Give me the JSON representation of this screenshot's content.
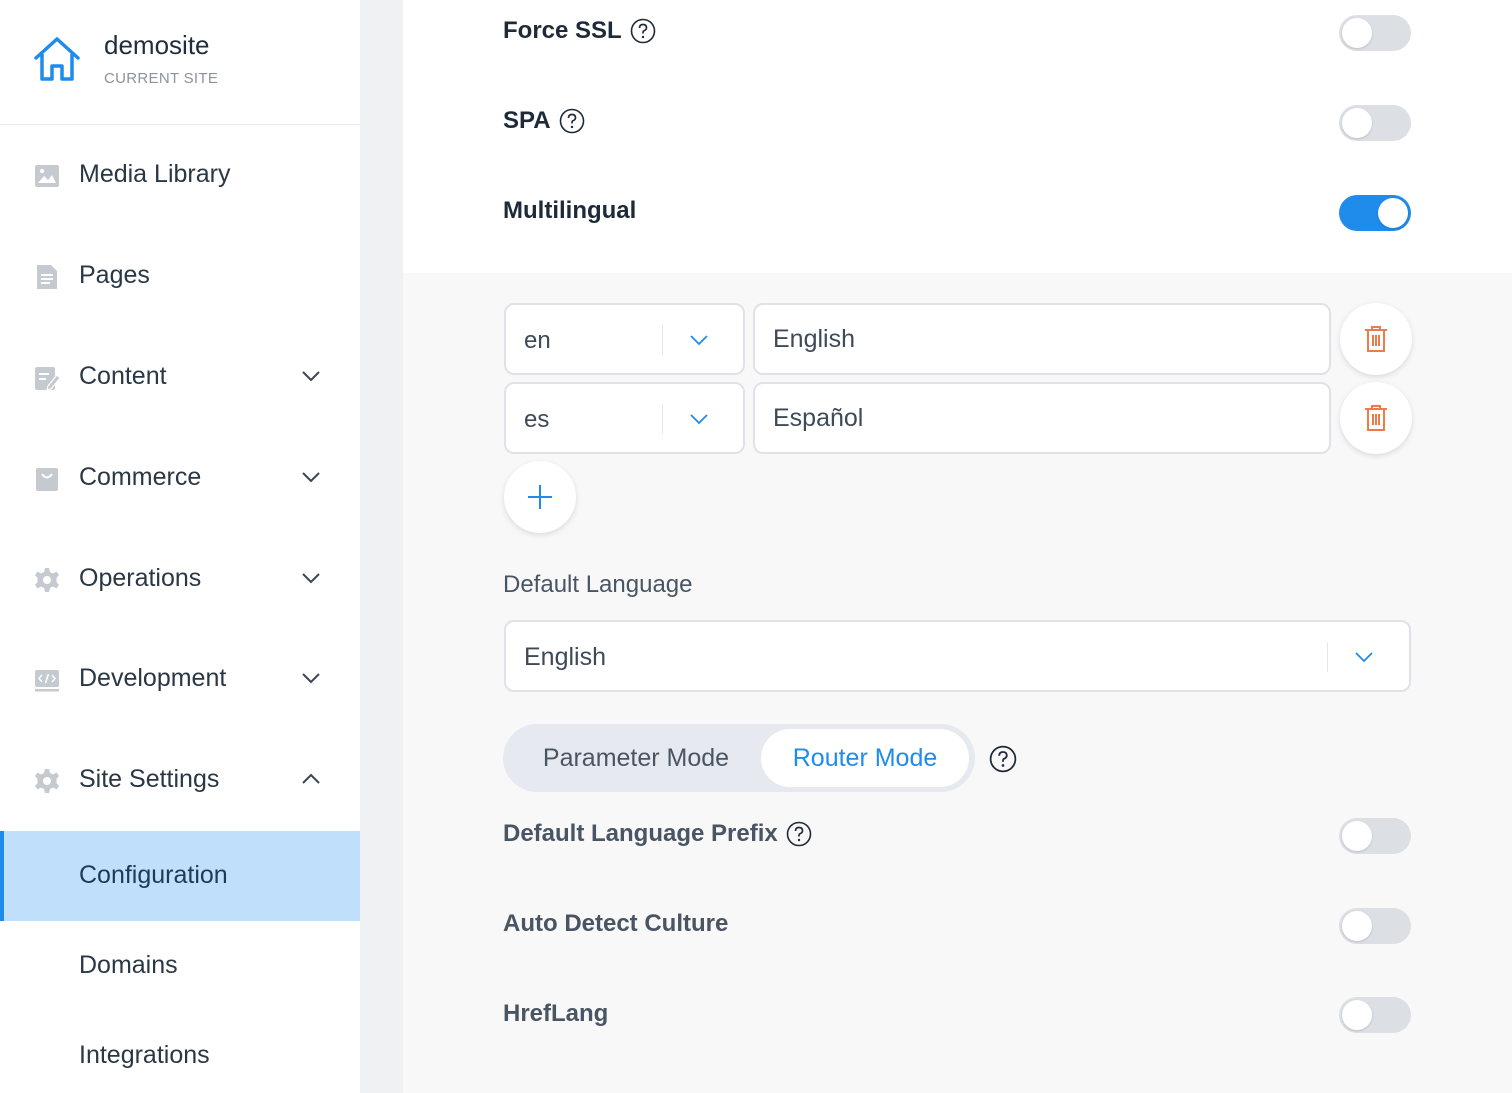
{
  "site": {
    "name": "demosite",
    "subtitle": "CURRENT SITE"
  },
  "sidebar": {
    "items": [
      {
        "label": "Media Library",
        "icon": "image-icon"
      },
      {
        "label": "Pages",
        "icon": "page-icon"
      },
      {
        "label": "Content",
        "icon": "content-icon",
        "expandable": true
      },
      {
        "label": "Commerce",
        "icon": "bag-icon",
        "expandable": true
      },
      {
        "label": "Operations",
        "icon": "gear-icon",
        "expandable": true
      },
      {
        "label": "Development",
        "icon": "code-icon",
        "expandable": true
      },
      {
        "label": "Site Settings",
        "icon": "gear-icon",
        "expanded": true
      }
    ],
    "subitems": [
      {
        "label": "Configuration",
        "active": true
      },
      {
        "label": "Domains"
      },
      {
        "label": "Integrations"
      }
    ]
  },
  "settings": {
    "force_ssl": {
      "label": "Force SSL",
      "enabled": false
    },
    "spa": {
      "label": "SPA",
      "enabled": false
    },
    "multilingual": {
      "label": "Multilingual",
      "enabled": true
    }
  },
  "languages": [
    {
      "code": "en",
      "name": "English"
    },
    {
      "code": "es",
      "name": "Español"
    }
  ],
  "default_language": {
    "label": "Default Language",
    "value": "English"
  },
  "mode": {
    "options": [
      "Parameter Mode",
      "Router Mode"
    ],
    "selected": "Router Mode"
  },
  "options": {
    "default_language_prefix": {
      "label": "Default Language Prefix",
      "enabled": false
    },
    "auto_detect_culture": {
      "label": "Auto Detect Culture",
      "enabled": false
    },
    "hreflang": {
      "label": "HrefLang",
      "enabled": false
    }
  },
  "colors": {
    "accent": "#1f8ceb",
    "active_nav_bg": "#bfdffb",
    "delete": "#f07a4a"
  }
}
